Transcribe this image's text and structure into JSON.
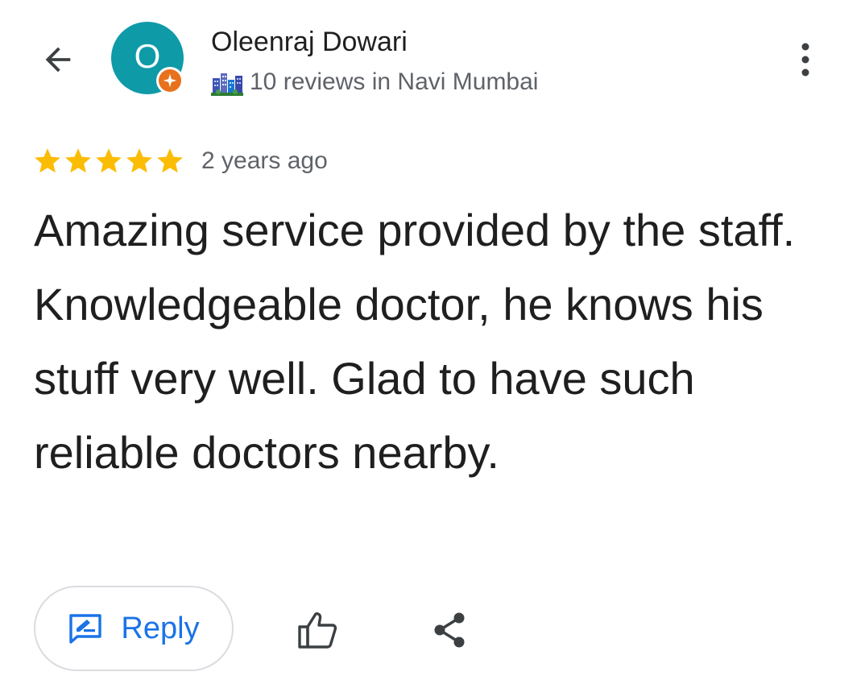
{
  "header": {
    "back_icon": "arrow-back-icon",
    "avatar": {
      "letter": "O",
      "background_color": "#0f9aa8",
      "badge_icon": "local-guide-badge-icon",
      "badge_color": "#e8711e"
    },
    "reviewer_name": "Oleenraj Dowari",
    "reviews_summary": "10 reviews in Navi Mumbai",
    "city_icon": "cityscape-icon",
    "more_icon": "more-vert-icon"
  },
  "review": {
    "rating": 5,
    "max_rating": 5,
    "star_color": "#fbbc04",
    "date": "2 years ago",
    "text": "Amazing service provided by the staff. Knowledgeable doctor, he knows his stuff very well. Glad to have such reliable doctors nearby."
  },
  "actions": {
    "reply_label": "Reply",
    "reply_icon": "rate-review-icon",
    "like_icon": "thumb-up-icon",
    "share_icon": "share-icon",
    "accent_color": "#1a73e8"
  }
}
